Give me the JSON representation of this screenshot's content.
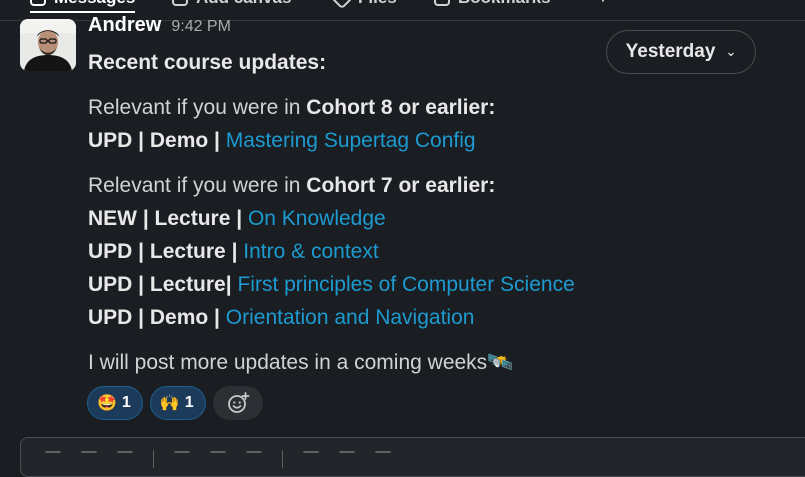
{
  "tabs": [
    {
      "label": "Messages",
      "icon": "message-icon",
      "active": true
    },
    {
      "label": "Add canvas",
      "icon": "canvas-icon",
      "active": false
    },
    {
      "label": "Files",
      "icon": "file-icon",
      "active": false
    },
    {
      "label": "Bookmarks",
      "icon": "bookmark-icon",
      "active": false
    },
    {
      "label": "+",
      "icon": "plus-icon",
      "active": false
    }
  ],
  "message": {
    "author": "Andrew",
    "time": "9:42 PM",
    "intro": "Recent course updates:",
    "blocks": [
      {
        "heading_prefix": "Relevant if you were in ",
        "heading_bold": "Cohort 8 or earlier:",
        "items": [
          {
            "prefix": "UPD | Demo | ",
            "link": "Mastering Supertag Config"
          }
        ]
      },
      {
        "heading_prefix": "Relevant if you were in ",
        "heading_bold": "Cohort 7 or earlier:",
        "items": [
          {
            "prefix": "NEW | Lecture | ",
            "link": "On Knowledge"
          },
          {
            "prefix": "UPD | Lecture | ",
            "link": "Intro & context"
          },
          {
            "prefix": "UPD | Lecture| ",
            "link": "First principles of Computer Science"
          },
          {
            "prefix": "UPD | Demo | ",
            "link": "Orientation and Navigation"
          }
        ]
      }
    ],
    "closing": "I will post more updates in a coming weeks",
    "closing_emoji": "🛰️"
  },
  "date_divider": {
    "label": "Yesterday"
  },
  "reactions": [
    {
      "emoji": "🤩",
      "count": "1",
      "name": "star-struck"
    },
    {
      "emoji": "🙌",
      "count": "1",
      "name": "raised-hands"
    }
  ],
  "colors": {
    "background": "#1a1d21",
    "link": "#1d9bd1",
    "reaction_bg": "#1c3b5a",
    "reaction_border": "#1d5e8f"
  }
}
